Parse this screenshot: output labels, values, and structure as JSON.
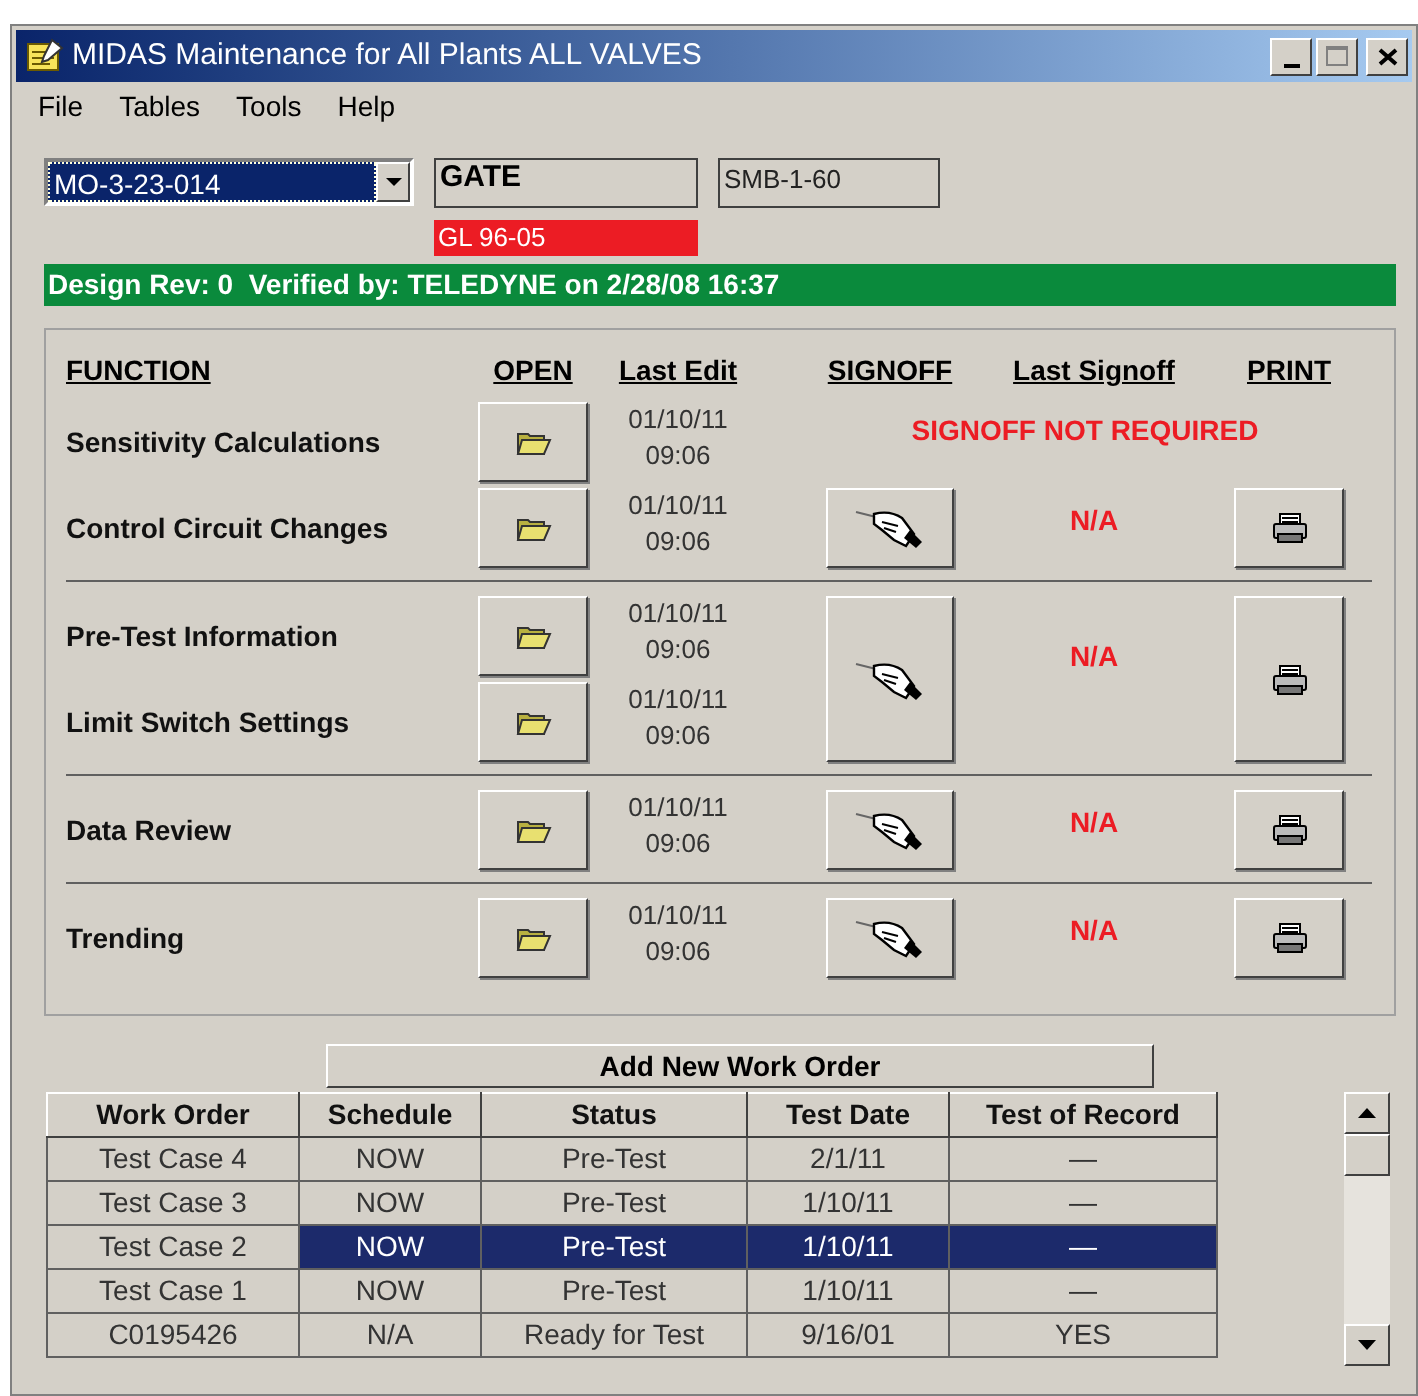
{
  "window": {
    "title": "MIDAS Maintenance for All Plants ALL VALVES"
  },
  "menu": [
    "File",
    "Tables",
    "Tools",
    "Help"
  ],
  "valve_select": {
    "value": "MO-3-23-014"
  },
  "type_field": {
    "value": "GATE"
  },
  "id_field": {
    "value": "SMB-1-60"
  },
  "alert_tag": {
    "text": "GL 96-05"
  },
  "status_banner": {
    "text": "Design Rev: 0  Verified by: TELEDYNE on 2/28/08 16:37"
  },
  "functions_panel": {
    "headers": [
      "FUNCTION",
      "OPEN",
      "Last Edit",
      "SIGNOFF",
      "Last Signoff",
      "PRINT"
    ],
    "sections": [
      {
        "blocks": [
          {
            "kind": "not_required",
            "note": "SIGNOFF NOT REQUIRED",
            "functions": [
              {
                "name": "Sensitivity Calculations",
                "date": "01/10/11",
                "time": "09:06"
              }
            ]
          },
          {
            "kind": "signoff",
            "last_signoff": "N/A",
            "functions": [
              {
                "name": "Control Circuit Changes",
                "date": "01/10/11",
                "time": "09:06"
              }
            ]
          }
        ]
      },
      {
        "blocks": [
          {
            "kind": "signoff",
            "last_signoff": "N/A",
            "functions": [
              {
                "name": "Pre-Test Information",
                "date": "01/10/11",
                "time": "09:06"
              },
              {
                "name": "Limit Switch Settings",
                "date": "01/10/11",
                "time": "09:06"
              }
            ]
          }
        ]
      },
      {
        "blocks": [
          {
            "kind": "signoff",
            "last_signoff": "N/A",
            "functions": [
              {
                "name": "Data Review",
                "date": "01/10/11",
                "time": "09:06"
              }
            ]
          }
        ]
      },
      {
        "blocks": [
          {
            "kind": "signoff",
            "last_signoff": "N/A",
            "functions": [
              {
                "name": "Trending",
                "date": "01/10/11",
                "time": "09:06"
              }
            ]
          }
        ]
      }
    ]
  },
  "add_button": {
    "label": "Add New Work Order"
  },
  "table": {
    "columns": [
      "Work Order",
      "Schedule",
      "Status",
      "Test Date",
      "Test of Record"
    ],
    "rows": [
      {
        "cells": [
          "Test Case 4",
          "NOW",
          "Pre-Test",
          "2/1/11",
          "—"
        ],
        "selected": false
      },
      {
        "cells": [
          "Test Case 3",
          "NOW",
          "Pre-Test",
          "1/10/11",
          "—"
        ],
        "selected": false
      },
      {
        "cells": [
          "Test Case 2",
          "NOW",
          "Pre-Test",
          "1/10/11",
          "—"
        ],
        "selected": true
      },
      {
        "cells": [
          "Test Case 1",
          "NOW",
          "Pre-Test",
          "1/10/11",
          "—"
        ],
        "selected": false
      },
      {
        "cells": [
          "C0195426",
          "N/A",
          "Ready for Test",
          "9/16/01",
          "YES"
        ],
        "selected": false
      }
    ]
  }
}
